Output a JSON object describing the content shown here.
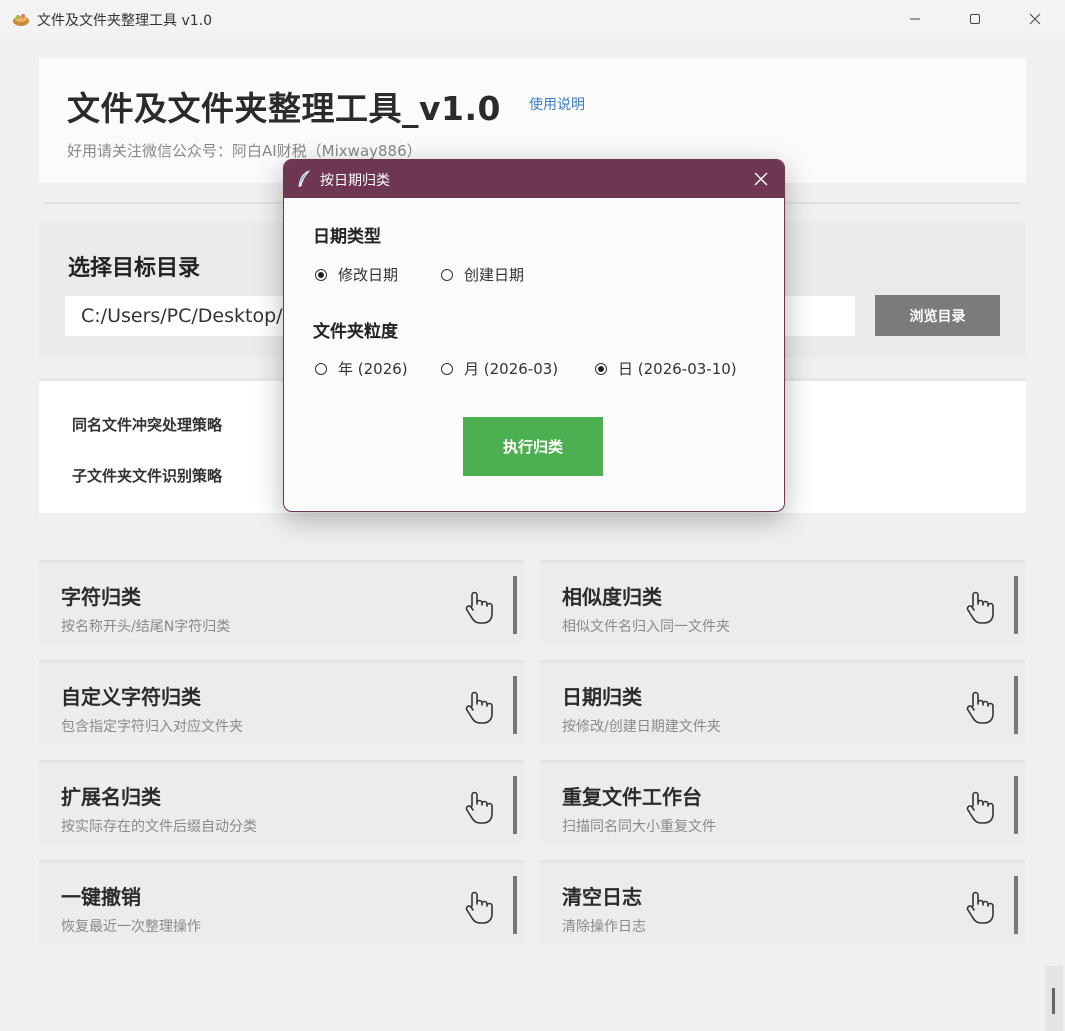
{
  "window": {
    "title": "文件及文件夹整理工具 v1.0",
    "minimize": "—",
    "maximize": "☐",
    "close": "✕"
  },
  "header": {
    "title": "文件及文件夹整理工具_v1.0",
    "help_link": "使用说明",
    "subtitle": "好用请关注微信公众号：阿白AI财税（Mixway886）"
  },
  "target_dir": {
    "heading": "选择目标目录",
    "path_value": "C:/Users/PC/Desktop/",
    "browse_label": "浏览目录"
  },
  "strategies": {
    "conflict_label": "同名文件冲突处理策略",
    "subfolder_label": "子文件夹文件识别策略"
  },
  "tiles": [
    {
      "title": "字符归类",
      "desc": "按名称开头/结尾N字符归类"
    },
    {
      "title": "相似度归类",
      "desc": "相似文件名归入同一文件夹"
    },
    {
      "title": "自定义字符归类",
      "desc": "包含指定字符归入对应文件夹"
    },
    {
      "title": "日期归类",
      "desc": "按修改/创建日期建文件夹"
    },
    {
      "title": "扩展名归类",
      "desc": "按实际存在的文件后缀自动分类"
    },
    {
      "title": "重复文件工作台",
      "desc": "扫描同名同大小重复文件"
    },
    {
      "title": "一键撤销",
      "desc": "恢复最近一次整理操作"
    },
    {
      "title": "清空日志",
      "desc": "清除操作日志"
    }
  ],
  "dialog": {
    "title": "按日期归类",
    "close": "✕",
    "date_type": {
      "heading": "日期类型",
      "options": [
        "修改日期",
        "创建日期"
      ],
      "selected": "修改日期"
    },
    "granularity": {
      "heading": "文件夹粒度",
      "options": [
        "年 (2026)",
        "月 (2026-03)",
        "日 (2026-03-10)"
      ],
      "selected": "日 (2026-03-10)"
    },
    "execute_label": "执行归类"
  },
  "colors": {
    "dialog_titlebar": "#6e3653",
    "execute_button": "#4caf50",
    "browse_button": "#7b7b7b",
    "help_link": "#3d7cc9"
  }
}
